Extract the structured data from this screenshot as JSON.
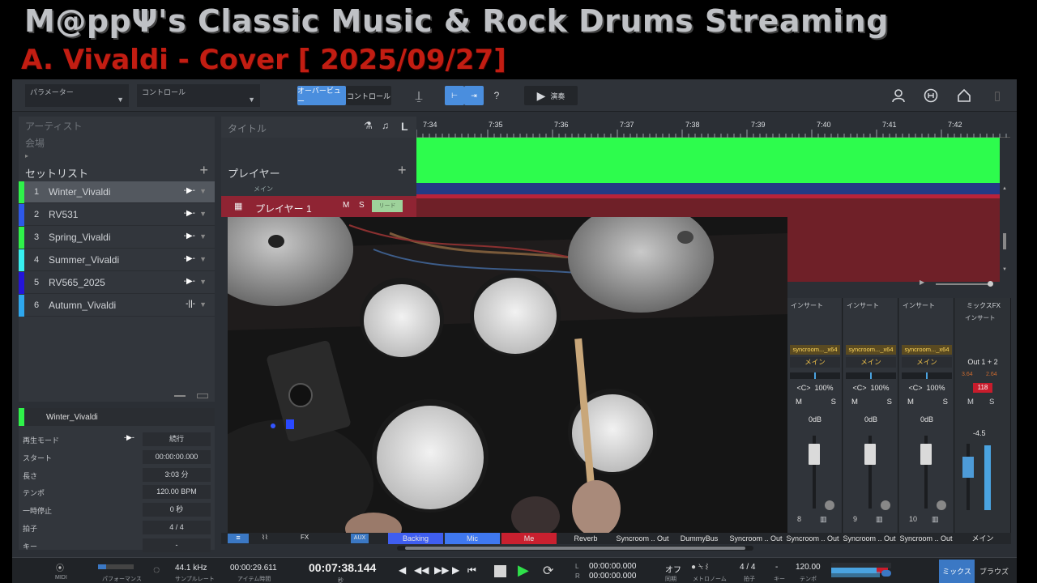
{
  "overlay": {
    "title": "M@ppΨ's Classic Music & Rock Drums Streaming",
    "subtitle": "A. Vivaldi -  Cover  [ 2025/09/27]"
  },
  "toolbar": {
    "param_label": "パラメーター",
    "control_label": "コントロール",
    "overview_label": "オーバービュー",
    "control_tab_label": "コントロール",
    "help_label": "?",
    "perform_label": "演奏"
  },
  "left_panel": {
    "artist_placeholder": "アーティスト",
    "venue_placeholder": "会場",
    "setlist_title": "セットリスト",
    "items": [
      {
        "num": "1",
        "name": "Winter_Vivaldi",
        "color": "#2ff24a",
        "mode": "-▶-"
      },
      {
        "num": "2",
        "name": "RV531",
        "color": "#2d58e8",
        "mode": "-▶-"
      },
      {
        "num": "3",
        "name": "Spring_Vivaldi",
        "color": "#2ff24a",
        "mode": "-▶-"
      },
      {
        "num": "4",
        "name": "Summer_Vivaldi",
        "color": "#37f0f0",
        "mode": "-▶-"
      },
      {
        "num": "5",
        "name": "RV565_2025",
        "color": "#2414d8",
        "mode": "-▶-"
      },
      {
        "num": "6",
        "name": "Autumn_Vivaldi",
        "color": "#2ea7ee",
        "mode": "-||-"
      }
    ]
  },
  "detail": {
    "title": "Winter_Vivaldi",
    "rows": [
      {
        "label": "再生モード",
        "value": "続行"
      },
      {
        "label": "スタート",
        "value": "00:00:00.000"
      },
      {
        "label": "長さ",
        "value": "3:03 分"
      },
      {
        "label": "テンポ",
        "value": "120.00 BPM"
      },
      {
        "label": "一時停止",
        "value": "0 秒"
      },
      {
        "label": "拍子",
        "value": "4     /     4"
      },
      {
        "label": "キー",
        "value": "-"
      }
    ]
  },
  "arrange": {
    "title_col": "タイトル",
    "player_header": "プレイヤー",
    "sub_label": "メイン",
    "player1": "プレイヤー 1",
    "m": "M",
    "s": "S",
    "lead": "リード",
    "ruler_ticks": [
      "7:34",
      "7:35",
      "7:36",
      "7:37",
      "7:38",
      "7:39",
      "7:40",
      "7:41",
      "7:42"
    ]
  },
  "mixer": {
    "channels": [
      {
        "insert": "インサート",
        "plugin": "syncroom..._x64",
        "route": "メイン",
        "pan": "<C>",
        "pct": "100%",
        "vol": "0dB",
        "num": "8"
      },
      {
        "insert": "インサート",
        "plugin": "syncroom..._x64",
        "route": "メイン",
        "pan": "<C>",
        "pct": "100%",
        "vol": "0dB",
        "num": "9"
      },
      {
        "insert": "インサート",
        "plugin": "syncroom..._x64",
        "route": "メイン",
        "pan": "<C>",
        "pct": "100%",
        "vol": "0dB",
        "num": "10"
      }
    ],
    "main": {
      "fx": "ミックスFX",
      "insert": "インサート",
      "out": "Out 1 + 2",
      "peak_l": "3.64",
      "peak_r": "2.64",
      "red_val": "118",
      "vol": "-4.5"
    },
    "m": "M",
    "s": "S"
  },
  "busbar": {
    "aux": "AUX",
    "labels": [
      "Backing",
      "Mic",
      "Me",
      "Reverb",
      "Syncroom .. Out",
      "DummyBus",
      "Syncroom .. Out",
      "Syncroom .. Out",
      "Syncroom .. Out",
      "Syncroom .. Out",
      "メイン"
    ],
    "colors": [
      "#3f5ef0",
      "#3f78f0",
      "#c9202f",
      "",
      "",
      "",
      "",
      "",
      "",
      "",
      ""
    ]
  },
  "transport": {
    "midi": "MIDI",
    "performance": "パフォーマンス",
    "sample_rate": "44.1 kHz",
    "sample_rate_lbl": "サンプルレート",
    "item_time": "00:00:29.611",
    "item_time_lbl": "アイテム時間",
    "main_time": "00:07:38.144",
    "main_time_lbl": "秒",
    "l_time": "00:00:00.000",
    "r_time": "00:00:00.000",
    "sync": "オフ",
    "sync_lbl": "同期",
    "metronome_lbl": "メトロノーム",
    "signature": "4 / 4",
    "signature_lbl": "拍子",
    "key": "-",
    "key_lbl": "キー",
    "tempo": "120.00",
    "tempo_lbl": "テンポ",
    "mix": "ミックス",
    "browse": "ブラウズ"
  }
}
